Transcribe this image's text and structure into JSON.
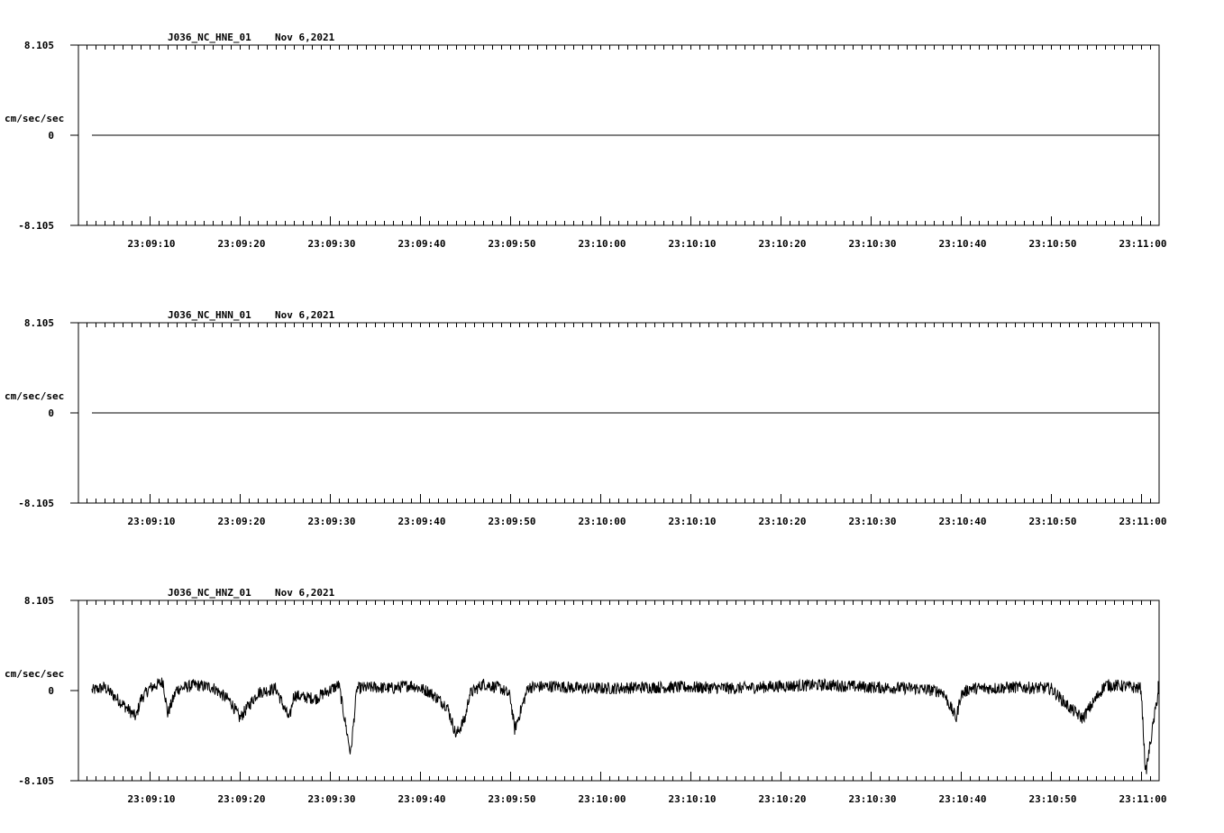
{
  "chart_data": [
    {
      "type": "line",
      "title": "J036_NC_HNE_01",
      "date": "Nov 6,2021",
      "ylabel": "cm/sec/sec",
      "ylim": [
        -8.105,
        8.105
      ],
      "ytick_labels": [
        "8.105",
        "0",
        "-8.105"
      ],
      "xtick_labels": [
        "23:09:10",
        "23:09:20",
        "23:09:30",
        "23:09:40",
        "23:09:50",
        "23:10:00",
        "23:10:10",
        "23:10:20",
        "23:10:30",
        "23:10:40",
        "23:10:50",
        "23:11:00"
      ],
      "series": [
        {
          "values_desc": "flat",
          "x": [
            "23:09:04",
            "23:11:01"
          ],
          "y": [
            0,
            0
          ]
        }
      ],
      "grid": false
    },
    {
      "type": "line",
      "title": "J036_NC_HNN_01",
      "date": "Nov 6,2021",
      "ylabel": "cm/sec/sec",
      "ylim": [
        -8.105,
        8.105
      ],
      "ytick_labels": [
        "8.105",
        "0",
        "-8.105"
      ],
      "xtick_labels": [
        "23:09:10",
        "23:09:20",
        "23:09:30",
        "23:09:40",
        "23:09:50",
        "23:10:00",
        "23:10:10",
        "23:10:20",
        "23:10:30",
        "23:10:40",
        "23:10:50",
        "23:11:00"
      ],
      "series": [
        {
          "values_desc": "flat",
          "x": [
            "23:09:04",
            "23:11:01"
          ],
          "y": [
            0,
            0
          ]
        }
      ],
      "grid": false
    },
    {
      "type": "line",
      "title": "J036_NC_HNZ_01",
      "date": "Nov 6,2021",
      "ylabel": "cm/sec/sec",
      "ylim": [
        -8.105,
        8.105
      ],
      "ytick_labels": [
        "8.105",
        "0",
        "-8.105"
      ],
      "xtick_labels": [
        "23:09:10",
        "23:09:20",
        "23:09:30",
        "23:09:40",
        "23:09:50",
        "23:10:00",
        "23:10:10",
        "23:10:20",
        "23:10:30",
        "23:10:40",
        "23:10:50",
        "23:11:00"
      ],
      "series": [
        {
          "x_seconds_after_23_09_00": [
            3.6,
            5,
            7,
            8.5,
            9,
            10,
            11.5,
            12,
            13,
            15,
            17,
            19,
            20,
            22,
            24,
            25.5,
            26,
            27,
            28.5,
            29,
            31,
            32.3,
            33,
            35,
            37,
            39,
            41,
            43,
            44,
            45,
            45.5,
            47,
            49,
            50,
            50.5,
            52,
            55,
            58,
            61,
            65,
            70,
            75,
            80,
            85,
            90,
            95,
            98,
            99.5,
            100,
            101,
            103,
            106,
            110,
            112,
            113.5,
            116,
            118,
            120,
            120.5,
            122,
            125
          ],
          "y": [
            0,
            0.3,
            -1.2,
            -2.4,
            -0.8,
            0.2,
            0.8,
            -2.1,
            0.1,
            0.5,
            0.3,
            -1.0,
            -2.5,
            -0.2,
            0.2,
            -2.6,
            -0.4,
            -0.6,
            -0.7,
            -0.4,
            0.5,
            -5.7,
            0.2,
            0.3,
            0.2,
            0.5,
            -0.1,
            -1.4,
            -4.0,
            -2.5,
            -0.3,
            0.6,
            0.2,
            -0.5,
            -3.5,
            0.3,
            0.4,
            0.2,
            0.2,
            0.3,
            0.3,
            0.2,
            0.4,
            0.5,
            0.3,
            0.2,
            -0.1,
            -2.5,
            -0.4,
            0.2,
            0.2,
            0.3,
            0.2,
            -1.5,
            -2.5,
            0.5,
            0.4,
            0.2,
            -7.5,
            0.4,
            0.1
          ]
        }
      ],
      "grid": false
    }
  ]
}
